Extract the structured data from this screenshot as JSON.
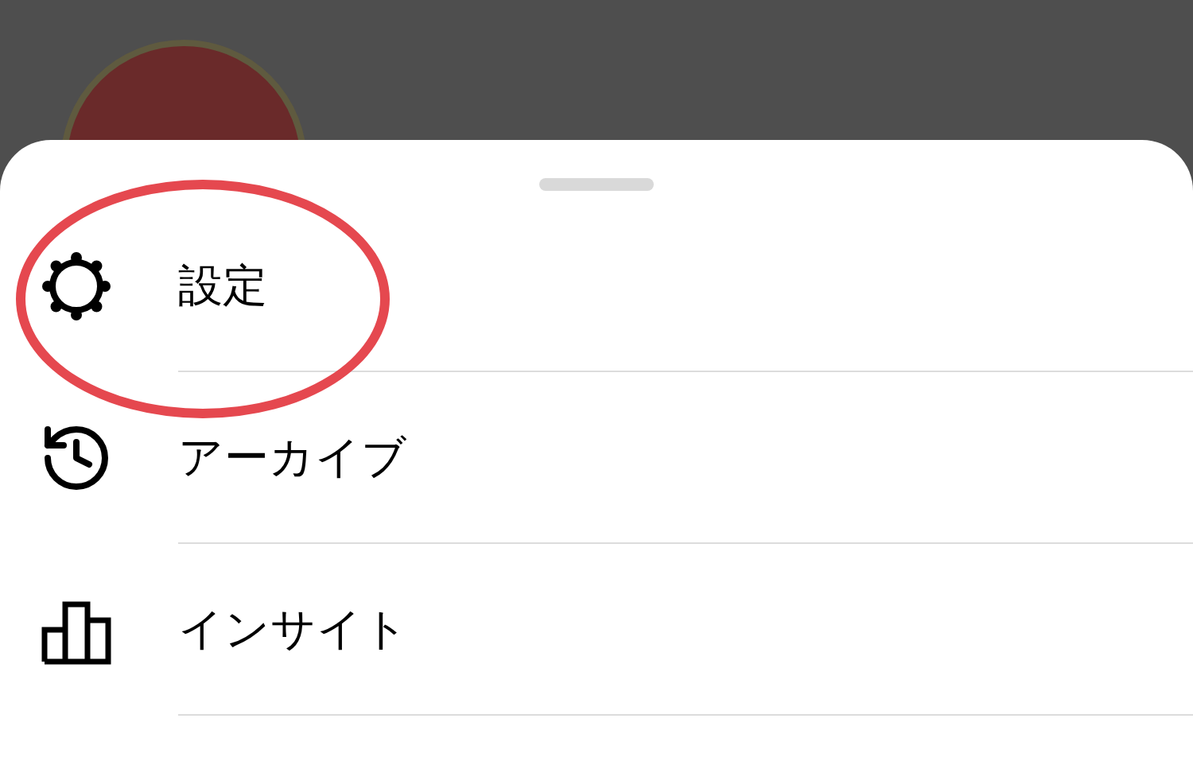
{
  "menu": {
    "items": [
      {
        "kind": "settings",
        "label": "設定",
        "circled": true
      },
      {
        "kind": "archive",
        "label": "アーカイブ",
        "circled": false
      },
      {
        "kind": "insights",
        "label": "インサイト",
        "circled": false
      }
    ]
  }
}
